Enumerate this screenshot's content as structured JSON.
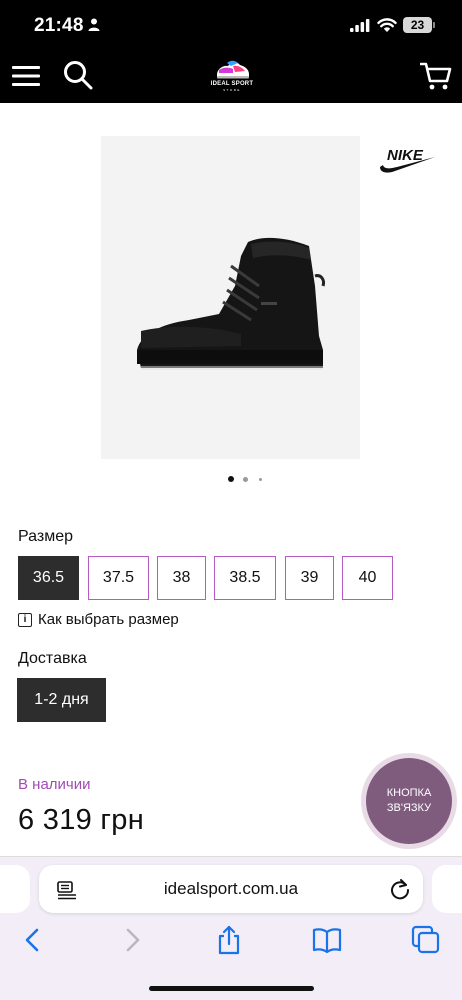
{
  "status_bar": {
    "time": "21:48",
    "battery": "23"
  },
  "header": {
    "logo_text": "IDEAL SPORT",
    "logo_subtext": "STORE"
  },
  "product": {
    "brand": "NIKE",
    "image_count": 3,
    "active_image_index": 0
  },
  "size": {
    "label": "Размер",
    "options": [
      "36.5",
      "37.5",
      "38",
      "38.5",
      "39",
      "40"
    ],
    "selected": "36.5",
    "guide_label": "Как выбрать размер",
    "guide_icon": "info-icon"
  },
  "delivery": {
    "label": "Доставка",
    "value": "1-2 дня"
  },
  "availability": "В наличии",
  "price": "6 319 грн",
  "callback": {
    "line1": "КНОПКА",
    "line2": "ЗВ'ЯЗКУ"
  },
  "browser": {
    "url": "idealsport.com.ua"
  },
  "colors": {
    "accent": "#b45cc4",
    "availability": "#a14bb4",
    "callback": "#7f5b7e",
    "selected": "#2d2d2d"
  }
}
